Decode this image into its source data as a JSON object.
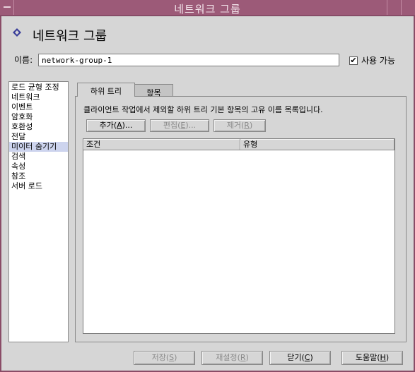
{
  "window": {
    "title": "네트워크 그룹"
  },
  "header": {
    "title": "네트워크 그룹",
    "icon": "diamond-icon"
  },
  "name_field": {
    "label": "이름:",
    "value": "network-group-1"
  },
  "enabled": {
    "label": "사용 가능",
    "checked": true
  },
  "sidebar": {
    "items": [
      {
        "label": "로드 균형 조정"
      },
      {
        "label": "네트워크"
      },
      {
        "label": "이벤트"
      },
      {
        "label": "암호화"
      },
      {
        "label": "호환성"
      },
      {
        "label": "전달"
      },
      {
        "label": "미이터 숨기기"
      },
      {
        "label": "검색"
      },
      {
        "label": "속성"
      },
      {
        "label": "참조"
      },
      {
        "label": "서버 로드"
      }
    ],
    "selected_index": 6
  },
  "tabs": [
    {
      "label": "하위 트리"
    },
    {
      "label": "항목"
    }
  ],
  "panel": {
    "description": "클라이언트 작업에서 제외할 하위 트리 기본 항목의 고유 이름 목록입니다.",
    "add_label": "추가",
    "add_key": "A",
    "edit_label": "편집",
    "edit_key": "E",
    "remove_label": "제거",
    "remove_key": "R"
  },
  "table": {
    "columns": [
      "조건",
      "유형"
    ]
  },
  "footer": {
    "save_label": "저장",
    "save_key": "S",
    "reset_label": "재설정",
    "reset_key": "R",
    "close_label": "닫기",
    "close_key": "C",
    "help_label": "도움말",
    "help_key": "H"
  }
}
